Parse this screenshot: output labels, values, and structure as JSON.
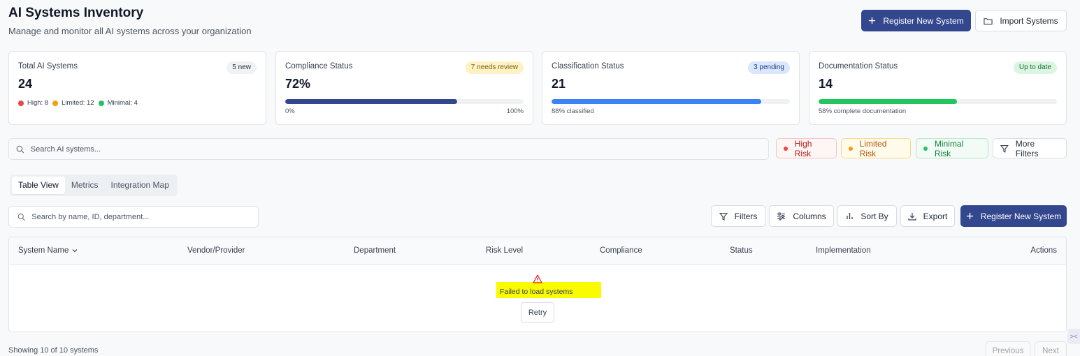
{
  "header": {
    "title": "AI Systems Inventory",
    "subtitle": "Manage and monitor all AI systems across your organization",
    "register_label": "Register New System",
    "import_label": "Import Systems"
  },
  "stats": {
    "total": {
      "label": "Total AI Systems",
      "value": "24",
      "badge": "5 new",
      "legend": [
        {
          "label": "High: 8",
          "color": "#ef4444"
        },
        {
          "label": "Limited: 12",
          "color": "#f59e0b"
        },
        {
          "label": "Minimal: 4",
          "color": "#22c55e"
        }
      ]
    },
    "compliance": {
      "label": "Compliance Status",
      "value": "72%",
      "badge": "7 needs review",
      "progress": 0.72,
      "min_label": "0%",
      "max_label": "100%",
      "color": "#33478e"
    },
    "classification": {
      "label": "Classification Status",
      "value": "21",
      "badge": "3 pending",
      "progress": 0.88,
      "foot": "88% classified",
      "color": "#3b82f6"
    },
    "documentation": {
      "label": "Documentation Status",
      "value": "14",
      "badge": "Up to date",
      "progress": 0.58,
      "foot": "58% complete documentation",
      "color": "#22c55e"
    }
  },
  "filters": {
    "search_placeholder": "Search AI systems...",
    "high_risk": "High Risk",
    "limited_risk": "Limited Risk",
    "minimal_risk": "Minimal Risk",
    "more_filters": "More Filters"
  },
  "tabs": [
    "Table View",
    "Metrics",
    "Integration Map"
  ],
  "toolbar": {
    "search_placeholder": "Search by name, ID, department...",
    "filters": "Filters",
    "columns": "Columns",
    "sort_by": "Sort By",
    "export": "Export",
    "register": "Register New System"
  },
  "table": {
    "columns": [
      "System Name",
      "Vendor/Provider",
      "Department",
      "Risk Level",
      "Compliance",
      "Status",
      "Implementation",
      "Actions"
    ],
    "error": "Failed to load systems",
    "retry": "Retry"
  },
  "footer": {
    "showing": "Showing 10 of 10 systems",
    "previous": "Previous",
    "next": "Next"
  },
  "side_tab_icon": "><"
}
